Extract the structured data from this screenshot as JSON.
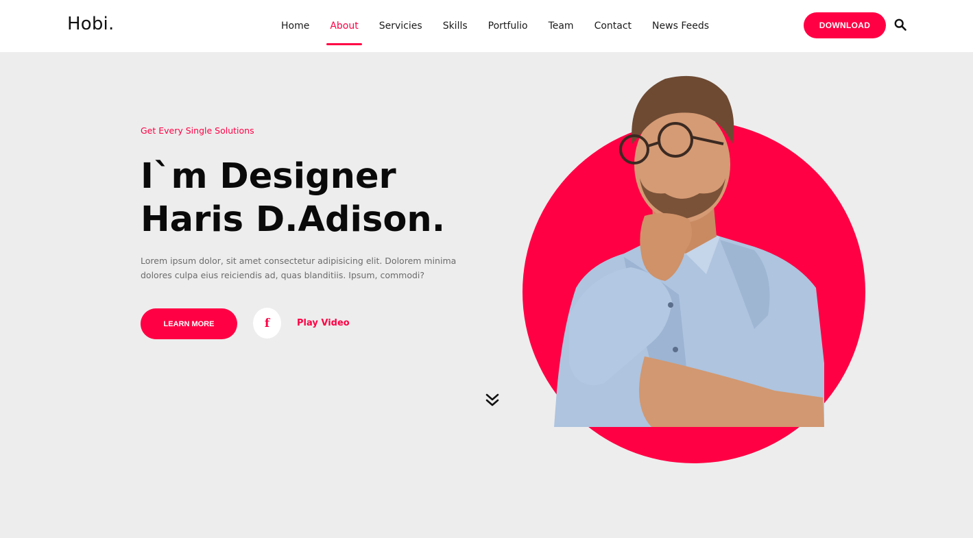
{
  "header": {
    "logo": "Hobi.",
    "nav": [
      {
        "label": "Home",
        "active": false
      },
      {
        "label": "About",
        "active": true
      },
      {
        "label": "Servicies",
        "active": false
      },
      {
        "label": "Skills",
        "active": false
      },
      {
        "label": "Portfulio",
        "active": false
      },
      {
        "label": "Team",
        "active": false
      },
      {
        "label": "Contact",
        "active": false
      },
      {
        "label": "News Feeds",
        "active": false
      }
    ],
    "download_label": "DOWNLOAD",
    "search_icon": "search-icon"
  },
  "hero": {
    "tagline": "Get Every Single Solutions",
    "title_line1": "I`m Designer",
    "title_line2": "Haris D.Adison.",
    "description": "Lorem ipsum dolor, sit amet consectetur adipisicing elit. Dolorem minima dolores culpa eius reiciendis ad, quas blanditiis. Ipsum, commodi?",
    "learn_more_label": "LEARN MORE",
    "facebook_icon_glyph": "f",
    "play_video_label": "Play Video",
    "scroll_icon": "double-chevron-down-icon"
  },
  "colors": {
    "accent": "#ff0044",
    "background": "#ededed",
    "header_bg": "#ffffff",
    "text_dark": "#0a0a0a"
  }
}
